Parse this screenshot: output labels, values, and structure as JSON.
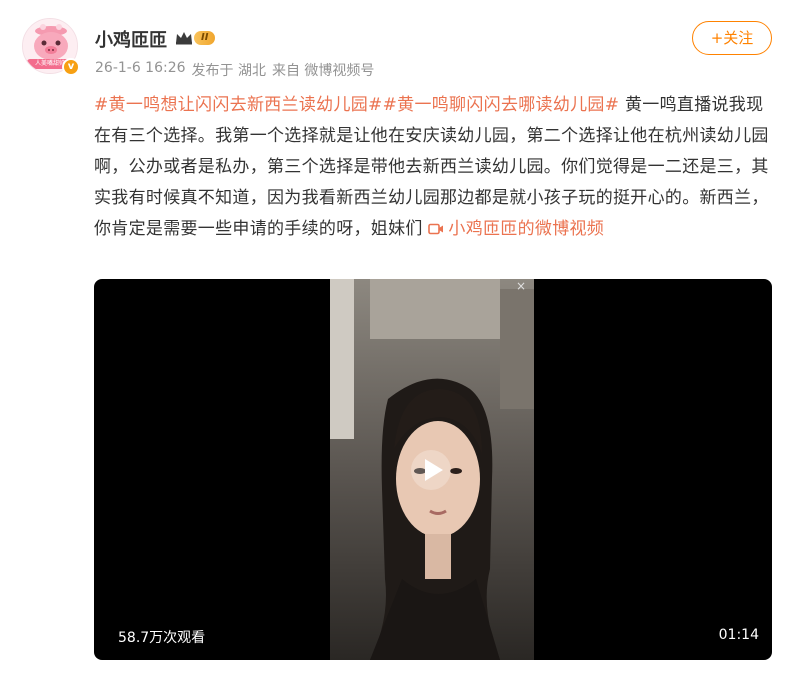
{
  "author": {
    "name": "小鸡匝匝",
    "level": "II",
    "avatar_banner": "人美嘴甜帅",
    "verified_icon": "verified-badge-icon"
  },
  "meta": {
    "time": "26-1-6 16:26",
    "published_in": "发布于 湖北",
    "source": "来自 微博视频号"
  },
  "follow_button": "+关注",
  "post": {
    "tags": [
      "#黄一鸣想让闪闪去新西兰读幼儿园#",
      "#黄一鸣聊闪闪去哪读幼儿园#"
    ],
    "body": " 黄一鸣直播说我现在有三个选择。我第一个选择就是让他在安庆读幼儿园，第二个选择让他在杭州读幼儿园啊，公办或者是私办，第三个选择是带他去新西兰读幼儿园。你们觉得是一二还是三，其实我有时候真不知道，因为我看新西兰幼儿园那边都是就小孩子玩的挺开心的。新西兰，你肯定是需要一些申请的手续的呀，姐妹们 ",
    "video_link": "小鸡匝匝的微博视频"
  },
  "video": {
    "views": "58.7万次观看",
    "duration": "01:14",
    "close_symbol": "×"
  },
  "colors": {
    "accent": "#eb7350",
    "follow": "#ff8200",
    "meta_gray": "#939393",
    "text": "#333333"
  }
}
